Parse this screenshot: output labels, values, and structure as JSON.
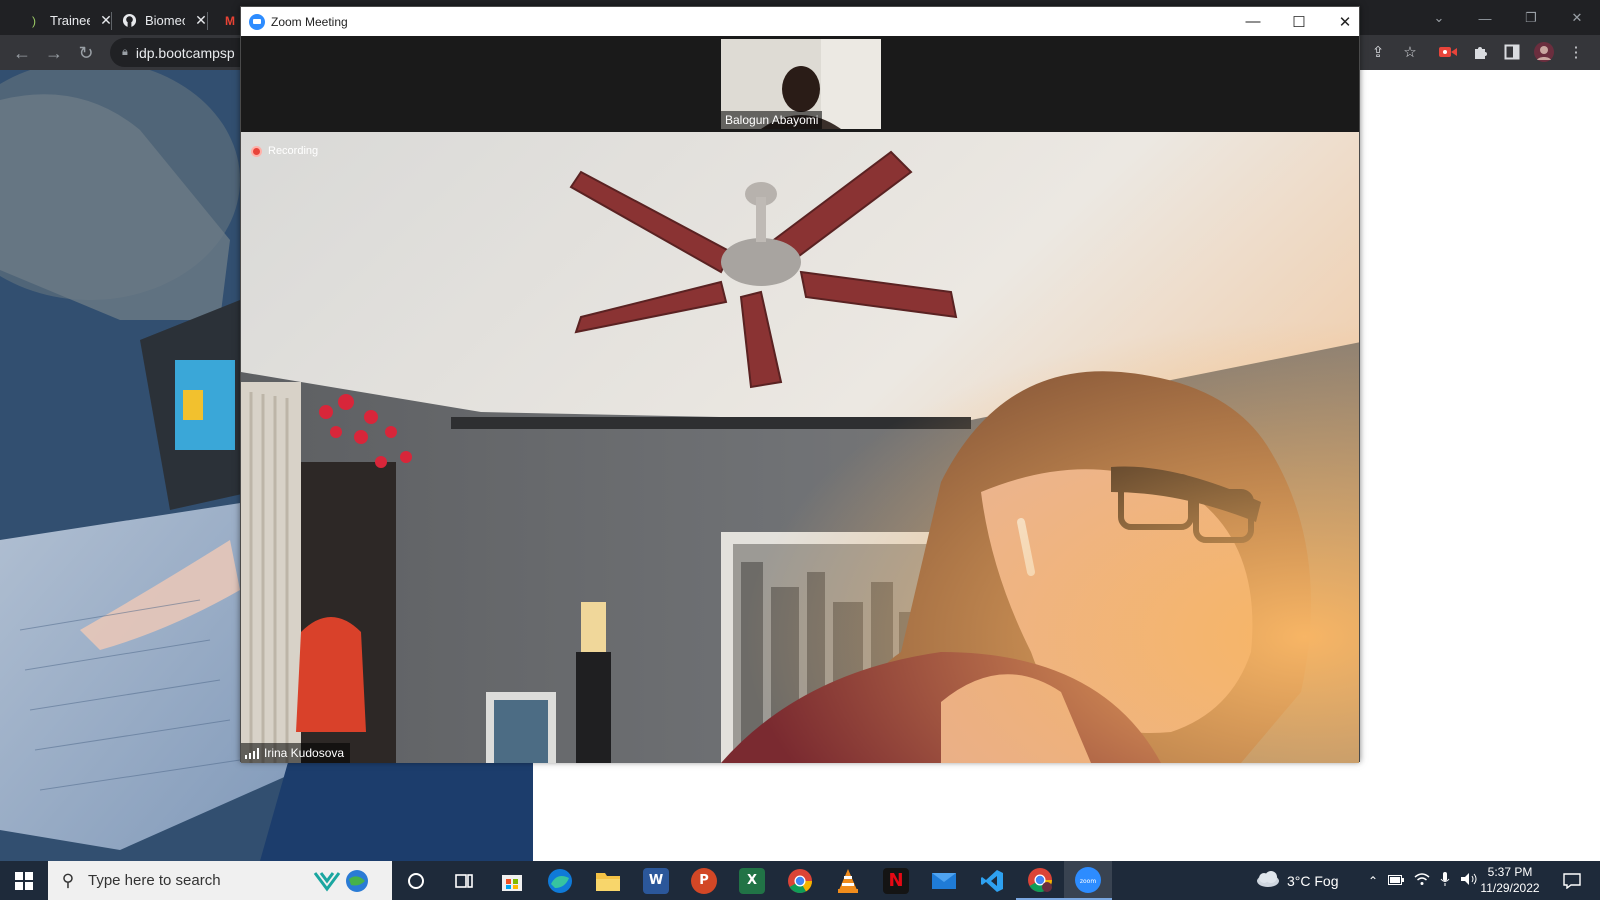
{
  "browser": {
    "tabs": [
      {
        "label": "Trainee",
        "icon": "bracket-icon"
      },
      {
        "label": "Biomec",
        "icon": "github-icon"
      },
      {
        "label": "M",
        "icon": "gmail-icon"
      }
    ],
    "address": "idp.bootcampsp",
    "toolbar_icons": [
      "share-icon",
      "star-icon",
      "record-extension-icon",
      "puzzle-icon",
      "side-panel-icon",
      "profile-avatar",
      "kebab-menu-icon"
    ]
  },
  "zoom": {
    "title": "Zoom Meeting",
    "thumbnail_participant": "Balogun Abayomi",
    "recording_label": "Recording",
    "speaker_name": "Irina Kudosova"
  },
  "taskbar": {
    "search_placeholder": "Type here to search",
    "weather": "3°C  Fog",
    "time": "5:37 PM",
    "date": "11/29/2022",
    "apps": [
      "task-view",
      "microsoft-store",
      "edge",
      "file-explorer",
      "word",
      "powerpoint",
      "excel",
      "chrome",
      "vlc",
      "netflix",
      "mail",
      "vscode",
      "chrome-profile",
      "zoom"
    ]
  },
  "colors": {
    "zoom_blue": "#2d8cff",
    "recording_red": "#e8443a",
    "taskbar_bg": "#1e2a3a"
  }
}
